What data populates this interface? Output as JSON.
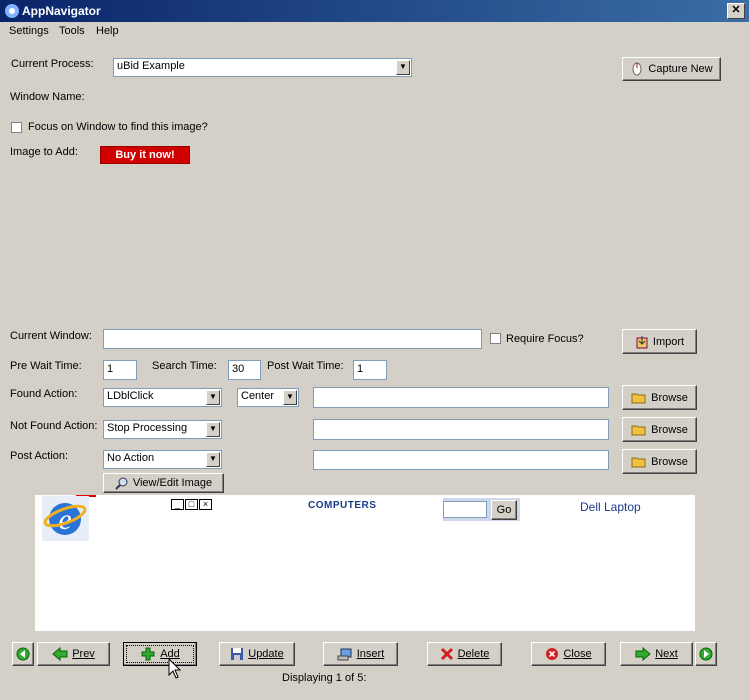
{
  "window": {
    "title": "AppNavigator",
    "close_glyph": "✕"
  },
  "menu": [
    "Settings",
    "Tools",
    "Help"
  ],
  "form": {
    "current_process_label": "Current Process:",
    "current_process_value": "uBid Example",
    "capture_new": "Capture New",
    "window_name_label": "Window Name:",
    "focus_checkbox_label": "Focus on Window to find this image?",
    "image_to_add_label": "Image to Add:",
    "buy_it_now": "Buy it now!",
    "current_window_label": "Current Window:",
    "current_window_value": "",
    "require_focus_label": "Require Focus?",
    "import": "Import",
    "pre_wait_label": "Pre Wait Time:",
    "pre_wait_value": "1",
    "search_time_label": "Search Time:",
    "search_time_value": "30",
    "post_wait_label": "Post Wait Time:",
    "post_wait_value": "1",
    "found_action_label": "Found Action:",
    "found_action_value": "LDblClick",
    "found_position_value": "Center",
    "found_action_path": "",
    "not_found_action_label": "Not Found Action:",
    "not_found_action_value": "Stop Processing",
    "not_found_action_path": "",
    "post_action_label": "Post Action:",
    "post_action_value": "No Action",
    "post_action_path": "",
    "browse": "Browse",
    "view_edit_image": "View/Edit Image"
  },
  "preview": {
    "computers": "COMPUTERS",
    "go": "Go",
    "dell_laptop": "Dell Laptop"
  },
  "nav": {
    "prev": "Prev",
    "add": "Add",
    "update": "Update",
    "insert": "Insert",
    "delete": "Delete",
    "close": "Close",
    "next": "Next",
    "status": "Displaying 1 of 5:"
  },
  "colors": {
    "title_start": "#0a246a",
    "title_end": "#3a6ea5",
    "buy_red": "#d00000",
    "face": "#d4d0c8"
  }
}
